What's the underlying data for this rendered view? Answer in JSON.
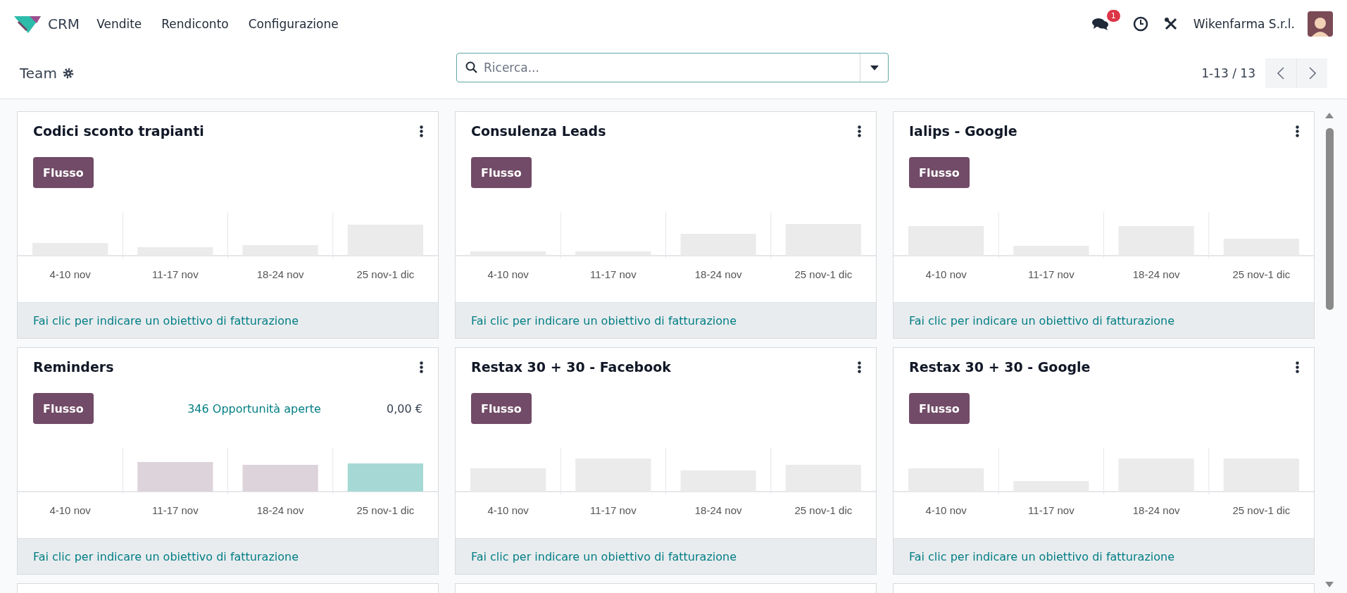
{
  "navbar": {
    "app_name": "CRM",
    "menus": [
      "Vendite",
      "Rendiconto",
      "Configurazione"
    ],
    "chat_badge": "1",
    "company": "Wikenfarma S.r.l."
  },
  "control_panel": {
    "title": "Team",
    "search": {
      "placeholder": "Ricerca..."
    },
    "pager": "1-13 / 13"
  },
  "cards": [
    {
      "name": "Codici sconto trapianti",
      "button": "Flusso",
      "weeks": [
        "4-10 nov",
        "11-17 nov",
        "18-24 nov",
        "25 nov-1 dic"
      ],
      "footer": "Fai clic per indicare un obiettivo di fatturazione"
    },
    {
      "name": "Consulenza Leads",
      "button": "Flusso",
      "weeks": [
        "4-10 nov",
        "11-17 nov",
        "18-24 nov",
        "25 nov-1 dic"
      ],
      "footer": "Fai clic per indicare un obiettivo di fatturazione"
    },
    {
      "name": "Ialips - Google",
      "button": "Flusso",
      "weeks": [
        "4-10 nov",
        "11-17 nov",
        "18-24 nov",
        "25 nov-1 dic"
      ],
      "footer": "Fai clic per indicare un obiettivo di fatturazione"
    },
    {
      "name": "Reminders",
      "button": "Flusso",
      "opportunities": "346 Opportunità aperte",
      "amount": "0,00 €",
      "weeks": [
        "4-10 nov",
        "11-17 nov",
        "18-24 nov",
        "25 nov-1 dic"
      ],
      "footer": "Fai clic per indicare un obiettivo di fatturazione"
    },
    {
      "name": "Restax 30 + 30 - Facebook",
      "button": "Flusso",
      "weeks": [
        "4-10 nov",
        "11-17 nov",
        "18-24 nov",
        "25 nov-1 dic"
      ],
      "footer": "Fai clic per indicare un obiettivo di fatturazione"
    },
    {
      "name": "Restax 30 + 30 - Google",
      "button": "Flusso",
      "weeks": [
        "4-10 nov",
        "11-17 nov",
        "18-24 nov",
        "25 nov-1 dic"
      ],
      "footer": "Fai clic per indicare un obiettivo di fatturazione"
    }
  ]
}
